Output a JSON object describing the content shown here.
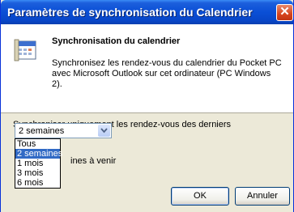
{
  "window": {
    "title": "Paramètres de synchronisation du Calendrier",
    "close_glyph": "✕"
  },
  "header": {
    "icon": "calendar-icon",
    "title": "Synchronisation du calendrier",
    "description": "Synchronisez les rendez-vous du calendrier du Pocket PC avec Microsoft Outlook sur cet ordinateur (PC Windows 2)."
  },
  "sync": {
    "label": "Synchroniser uniquement les rendez-vous des derniers",
    "selected": "2 semaines",
    "options": [
      "Tous",
      "2 semaines",
      "1 mois",
      "3 mois",
      "6 mois"
    ],
    "future_partial_label": "ines à venir"
  },
  "buttons": {
    "ok": "OK",
    "cancel": "Annuler"
  },
  "colors": {
    "titlebar": "#0a4fd6",
    "selection": "#316ac5",
    "dialog_bg": "#ece9d8"
  }
}
